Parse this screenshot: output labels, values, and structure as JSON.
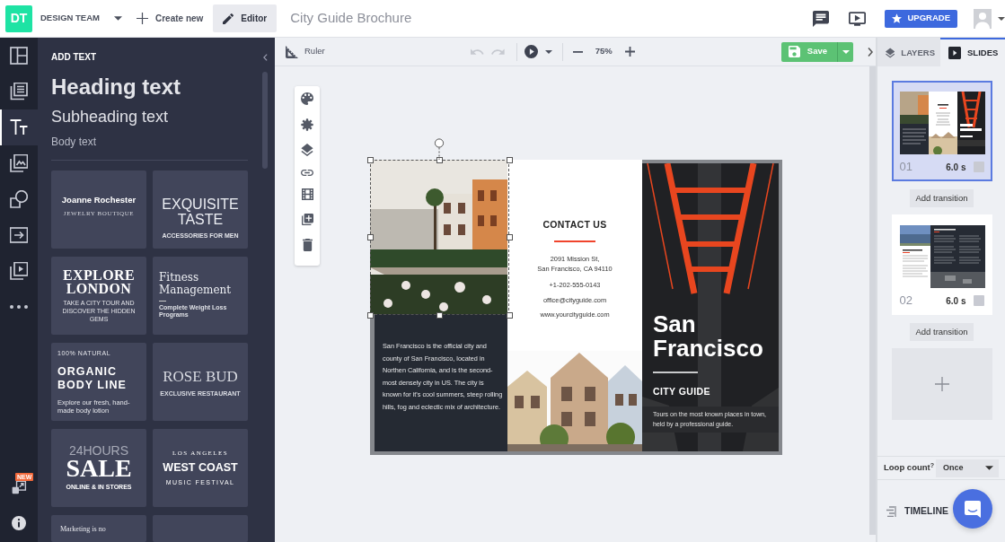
{
  "top_bar": {
    "logo": "DT",
    "team": "DESIGN TEAM",
    "create_button": "Create new",
    "editor_button": {
      "label": "Editor",
      "selected": true
    },
    "document_title": "City Guide Brochure",
    "upgrade_button": "UPGRADE"
  },
  "side_rail": {
    "items": [
      {
        "selected": false
      },
      {
        "selected": false
      },
      {
        "selected": true
      },
      {
        "selected": false
      },
      {
        "selected": false
      },
      {
        "selected": false
      },
      {
        "selected": false
      },
      {
        "selected": false
      }
    ],
    "new_badge": "NEW"
  },
  "text_panel": {
    "title": "ADD TEXT",
    "heading": "Heading text",
    "subheading": "Subheading text",
    "body": "Body text",
    "templates": [
      {
        "kind": "boutique",
        "lines": [
          "Joanne Rochester",
          "JEWELRY BOUTIQUE"
        ]
      },
      {
        "kind": "accessories",
        "lines": [
          "EXQUISITE TASTE",
          "ACCESSORIES FOR MEN"
        ]
      },
      {
        "kind": "poster",
        "lines": [
          "EXPLORE LONDON",
          "TAKE A CITY TOUR AND DISCOVER THE HIDDEN GEMS"
        ]
      },
      {
        "kind": "fitness",
        "lines": [
          "Fitness Management",
          "Complete Weight Loss Programs"
        ]
      },
      {
        "kind": "organic",
        "lines": [
          "100% NATURAL",
          "ORGANIC BODY LINE",
          "Explore our fresh, hand-made body lotion"
        ]
      },
      {
        "kind": "restaurant",
        "lines": [
          "ROSE BUD",
          "EXCLUSIVE RESTAURANT"
        ]
      },
      {
        "kind": "sale",
        "lines": [
          "24HOURS",
          "SALE",
          "ONLINE & IN STORES"
        ]
      },
      {
        "kind": "festival",
        "lines": [
          "LOS ANGELES",
          "WEST COAST",
          "MUSIC FESTIVAL"
        ]
      },
      {
        "kind": "quote",
        "lines": [
          "Marketing is no"
        ]
      },
      {
        "kind": "blank"
      }
    ]
  },
  "toolbar": {
    "ruler": "Ruler",
    "undo": {
      "disabled": true
    },
    "redo": {
      "disabled": true
    },
    "zoom": "75%",
    "save": "Save"
  },
  "brochure": {
    "about": "San Francisco is the official city and county of San Francisco, located in Northen California, and is the second-most densely city in US. The city is known for it's cool summers, steep rolling hills, fog and eclectic mix of architecture.",
    "contact": {
      "title": "CONTACT US",
      "address": [
        "2091 Mission St,",
        "San Francisco, CA 94110"
      ],
      "phone": "+1-202-555-0143",
      "email": "office@cityguide.com",
      "website": "www.yourcityguide.com"
    },
    "cover": {
      "title": "San Francisco",
      "subtitle": "CITY GUIDE",
      "note": "Tours on the most known places in town, held by a professional guide."
    }
  },
  "right_panel": {
    "tabs": [
      {
        "label": "LAYERS",
        "selected": false
      },
      {
        "label": "SLIDES",
        "selected": true
      }
    ],
    "slides": [
      {
        "number": "01",
        "duration": "6.0 s",
        "selected": true,
        "transition": "Add transition"
      },
      {
        "number": "02",
        "duration": "6.0 s",
        "selected": false,
        "transition": "Add transition"
      }
    ],
    "loop_count": {
      "label": "Loop count$^{?}$",
      "value": "Once"
    },
    "timeline": "TIMELINE"
  }
}
